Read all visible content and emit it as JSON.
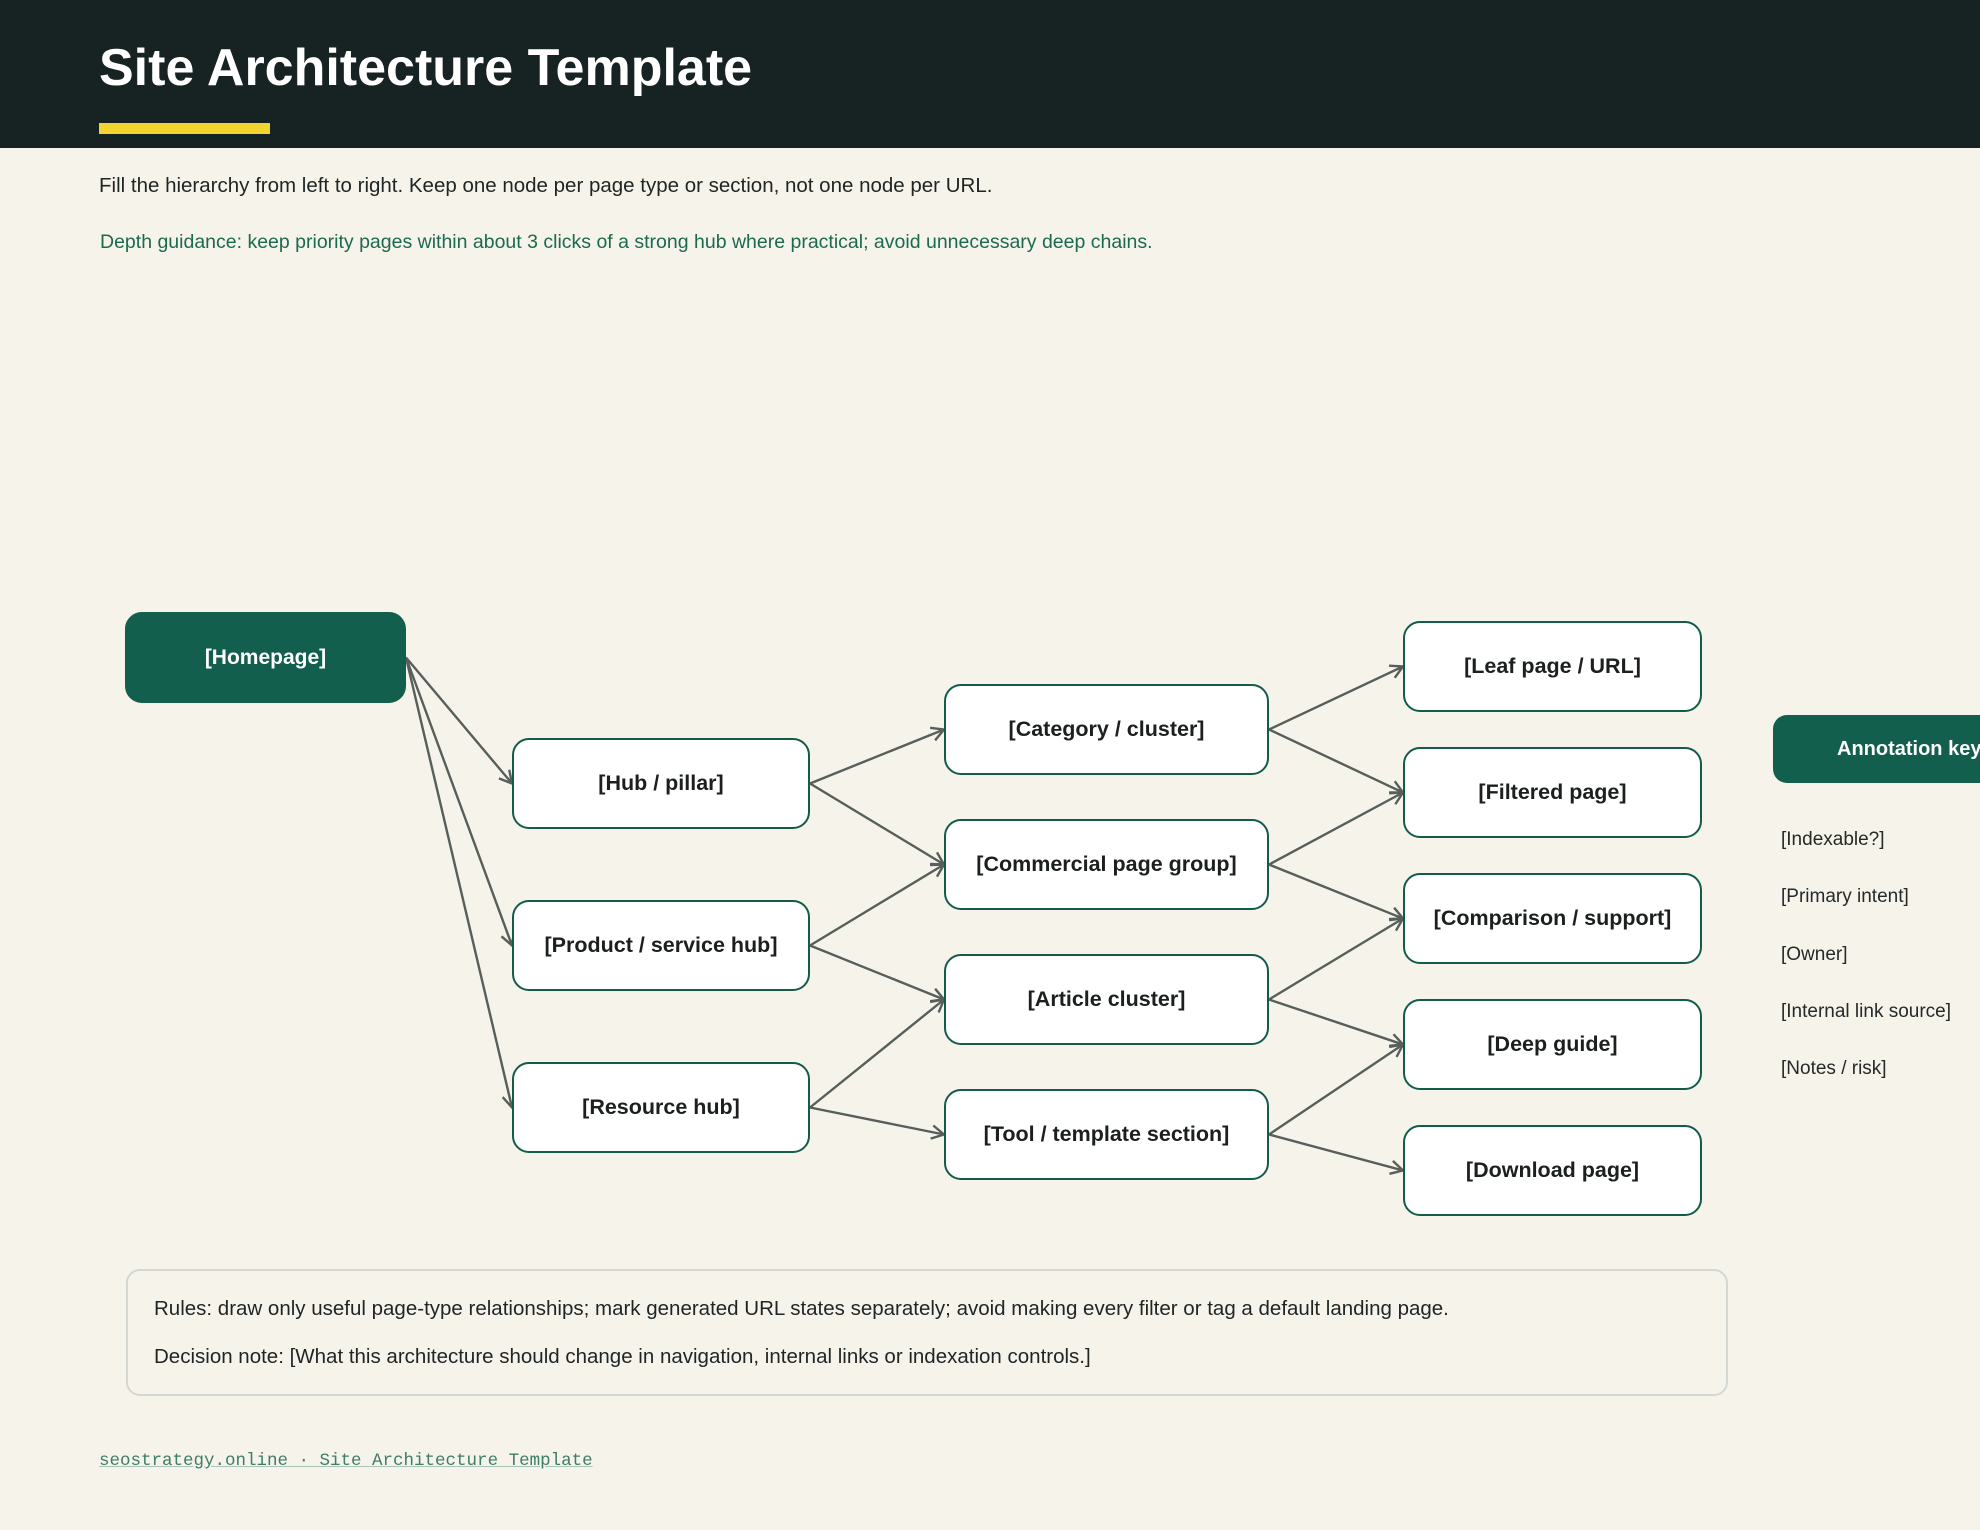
{
  "header": {
    "title": "Site Architecture Template"
  },
  "intro": "Fill the hierarchy from left to right. Keep one node per page type or section, not one node per URL.",
  "guidance": "Depth guidance: keep priority pages within about 3 clicks of a strong hub where practical; avoid unnecessary deep chains.",
  "diagram": {
    "nodes": {
      "homepage": "[Homepage]",
      "hub_pillar": "[Hub / pillar]",
      "product_service_hub": "[Product / service hub]",
      "resource_hub": "[Resource hub]",
      "category_cluster": "[Category / cluster]",
      "commercial_page_group": "[Commercial page group]",
      "article_cluster": "[Article cluster]",
      "tool_template_section": "[Tool / template section]",
      "leaf_page_url": "[Leaf page / URL]",
      "filtered_page": "[Filtered page]",
      "comparison_support": "[Comparison / support]",
      "deep_guide": "[Deep guide]",
      "download_page": "[Download page]"
    },
    "edges": [
      [
        "homepage",
        "hub_pillar"
      ],
      [
        "homepage",
        "product_service_hub"
      ],
      [
        "homepage",
        "resource_hub"
      ],
      [
        "hub_pillar",
        "category_cluster"
      ],
      [
        "hub_pillar",
        "commercial_page_group"
      ],
      [
        "product_service_hub",
        "commercial_page_group"
      ],
      [
        "product_service_hub",
        "article_cluster"
      ],
      [
        "resource_hub",
        "article_cluster"
      ],
      [
        "resource_hub",
        "tool_template_section"
      ],
      [
        "category_cluster",
        "leaf_page_url"
      ],
      [
        "category_cluster",
        "filtered_page"
      ],
      [
        "commercial_page_group",
        "filtered_page"
      ],
      [
        "commercial_page_group",
        "comparison_support"
      ],
      [
        "article_cluster",
        "comparison_support"
      ],
      [
        "article_cluster",
        "deep_guide"
      ],
      [
        "tool_template_section",
        "deep_guide"
      ],
      [
        "tool_template_section",
        "download_page"
      ]
    ]
  },
  "annotation_key": {
    "title": "Annotation key",
    "items": [
      "[Indexable?]",
      "[Primary intent]",
      "[Owner]",
      "[Internal link source]",
      "[Notes / risk]"
    ]
  },
  "rules": {
    "rules_text": "Rules: draw only useful page-type relationships; mark generated URL states separately; avoid making every filter or tag a default landing page.",
    "decision_note": "Decision note: [What this architecture should change in navigation, internal links or indexation controls.]"
  },
  "footer": "seostrategy.online · Site Architecture Template"
}
